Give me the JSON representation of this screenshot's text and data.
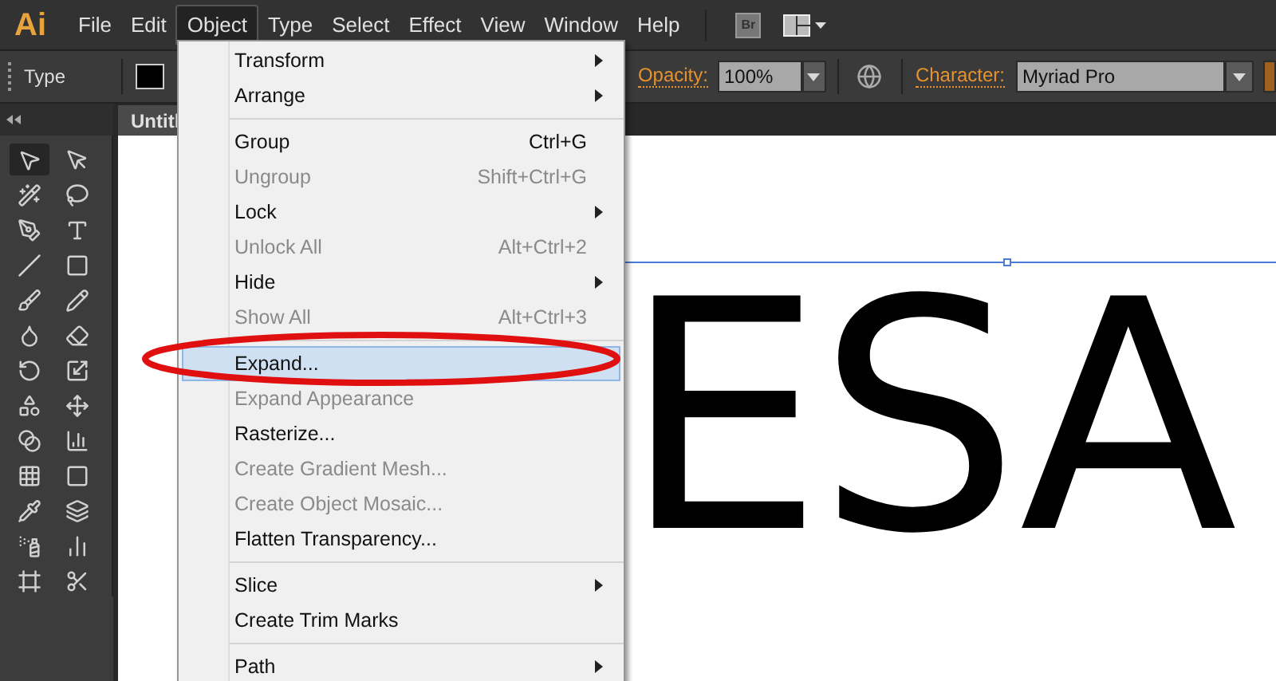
{
  "app_logo": "Ai",
  "menu_bar": [
    {
      "label": "File",
      "selected": false
    },
    {
      "label": "Edit",
      "selected": false
    },
    {
      "label": "Object",
      "selected": true
    },
    {
      "label": "Type",
      "selected": false
    },
    {
      "label": "Select",
      "selected": false
    },
    {
      "label": "Effect",
      "selected": false
    },
    {
      "label": "View",
      "selected": false
    },
    {
      "label": "Window",
      "selected": false
    },
    {
      "label": "Help",
      "selected": false
    }
  ],
  "bridge_button": "Br",
  "control_bar": {
    "label": "Type",
    "opacity_label": "Opacity:",
    "opacity_value": "100%",
    "character_label": "Character:",
    "font_value": "Myriad Pro"
  },
  "document_tab": "Untitl",
  "tools": [
    {
      "selected": true
    },
    {
      "selected": false
    },
    {
      "selected": false
    },
    {
      "selected": false
    },
    {
      "selected": false
    },
    {
      "selected": false
    },
    {
      "selected": false
    },
    {
      "selected": false
    },
    {
      "selected": false
    },
    {
      "selected": false
    },
    {
      "selected": false
    },
    {
      "selected": false
    },
    {
      "selected": false
    },
    {
      "selected": false
    },
    {
      "selected": false
    },
    {
      "selected": false
    },
    {
      "selected": false
    },
    {
      "selected": false
    },
    {
      "selected": false
    },
    {
      "selected": false
    },
    {
      "selected": false
    },
    {
      "selected": false
    },
    {
      "selected": false
    },
    {
      "selected": false
    },
    {
      "selected": false
    },
    {
      "selected": false
    }
  ],
  "object_menu": [
    {
      "kind": "item",
      "label": "Transform",
      "submenu": true,
      "disabled": false,
      "selected": false
    },
    {
      "kind": "item",
      "label": "Arrange",
      "submenu": true,
      "disabled": false,
      "selected": false
    },
    {
      "kind": "separator"
    },
    {
      "kind": "item",
      "label": "Group",
      "shortcut": "Ctrl+G",
      "submenu": false,
      "disabled": false,
      "selected": false
    },
    {
      "kind": "item",
      "label": "Ungroup",
      "shortcut": "Shift+Ctrl+G",
      "submenu": false,
      "disabled": true,
      "selected": false
    },
    {
      "kind": "item",
      "label": "Lock",
      "submenu": true,
      "disabled": false,
      "selected": false
    },
    {
      "kind": "item",
      "label": "Unlock All",
      "shortcut": "Alt+Ctrl+2",
      "submenu": false,
      "disabled": true,
      "selected": false
    },
    {
      "kind": "item",
      "label": "Hide",
      "submenu": true,
      "disabled": false,
      "selected": false
    },
    {
      "kind": "item",
      "label": "Show All",
      "shortcut": "Alt+Ctrl+3",
      "submenu": false,
      "disabled": true,
      "selected": false
    },
    {
      "kind": "separator"
    },
    {
      "kind": "item",
      "label": "Expand...",
      "submenu": false,
      "disabled": false,
      "selected": true
    },
    {
      "kind": "item",
      "label": "Expand Appearance",
      "submenu": false,
      "disabled": true,
      "selected": false
    },
    {
      "kind": "item",
      "label": "Rasterize...",
      "submenu": false,
      "disabled": false,
      "selected": false
    },
    {
      "kind": "item",
      "label": "Create Gradient Mesh...",
      "submenu": false,
      "disabled": true,
      "selected": false
    },
    {
      "kind": "item",
      "label": "Create Object Mosaic...",
      "submenu": false,
      "disabled": true,
      "selected": false
    },
    {
      "kind": "item",
      "label": "Flatten Transparency...",
      "submenu": false,
      "disabled": false,
      "selected": false
    },
    {
      "kind": "separator"
    },
    {
      "kind": "item",
      "label": "Slice",
      "submenu": true,
      "disabled": false,
      "selected": false
    },
    {
      "kind": "item",
      "label": "Create Trim Marks",
      "submenu": false,
      "disabled": false,
      "selected": false
    },
    {
      "kind": "separator"
    },
    {
      "kind": "item",
      "label": "Path",
      "submenu": true,
      "disabled": false,
      "selected": false
    }
  ],
  "canvas_text": "ESA"
}
